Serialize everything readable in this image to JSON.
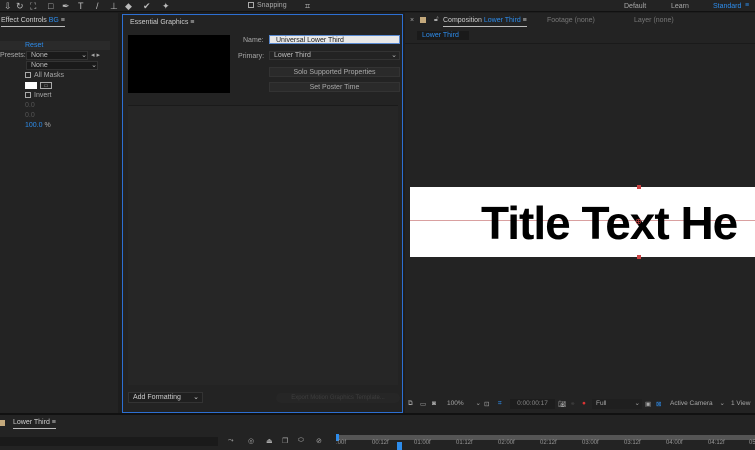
{
  "toolbar": {
    "snapping": "Snapping",
    "workspaces": [
      "Default",
      "Learn",
      "Standard"
    ]
  },
  "effect_controls": {
    "title": "Effect Controls",
    "layer": "BG",
    "reset": "Reset",
    "presets_label": "Presets:",
    "preset1": "None",
    "preset2": "None",
    "all_masks": "All Masks",
    "invert": "Invert",
    "val1": "0.0",
    "val2": "0.0",
    "opacity": "100.0",
    "opacity_unit": "%"
  },
  "essential_graphics": {
    "title": "Essential Graphics",
    "name_label": "Name:",
    "name_value": "Universal Lower Third",
    "primary_label": "Primary:",
    "primary_value": "Lower Third",
    "solo_button": "Solo Supported Properties",
    "poster_button": "Set Poster Time",
    "add_formatting": "Add Formatting",
    "export_button": "Export Motion Graphics Template..."
  },
  "composition": {
    "title": "Composition",
    "comp_name": "Lower Third",
    "footage": "Footage (none)",
    "layer": "Layer (none)",
    "tab": "Lower Third",
    "canvas_text": "Title Text He",
    "zoom": "100%",
    "timecode": "0:00:00:17",
    "resolution": "Full",
    "camera": "Active Camera",
    "views": "1 View"
  },
  "timeline": {
    "tab": "Lower Third",
    "ticks": [
      ":00f",
      "00:12f",
      "01:00f",
      "01:12f",
      "02:00f",
      "02:12f",
      "03:00f",
      "03:12f",
      "04:00f",
      "04:12f",
      "05"
    ]
  },
  "colors": {
    "accent": "#2d8ceb",
    "panel_border": "#2d6fd2",
    "canvas": "#ffffff"
  }
}
